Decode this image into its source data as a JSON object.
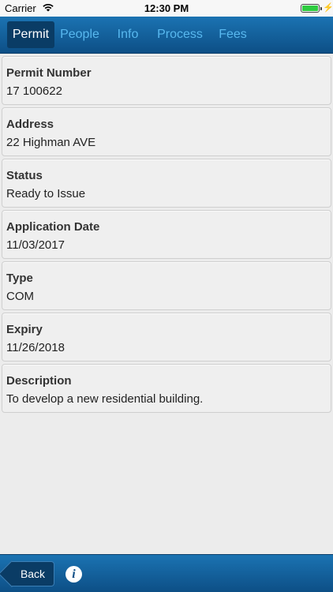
{
  "status_bar": {
    "carrier": "Carrier",
    "time": "12:30 PM",
    "charge_glyph": "⚡"
  },
  "tabs": [
    {
      "label": "Permit",
      "active": true
    },
    {
      "label": "People",
      "active": false
    },
    {
      "label": "Info",
      "active": false
    },
    {
      "label": "Process",
      "active": false
    },
    {
      "label": "Fees",
      "active": false
    }
  ],
  "fields": [
    {
      "label": "Permit Number",
      "value": "17 100622"
    },
    {
      "label": "Address",
      "value": "22 Highman AVE"
    },
    {
      "label": "Status",
      "value": "Ready to Issue"
    },
    {
      "label": "Application Date",
      "value": "11/03/2017"
    },
    {
      "label": "Type",
      "value": "COM"
    },
    {
      "label": "Expiry",
      "value": "11/26/2018"
    },
    {
      "label": "Description",
      "value": "To develop a new residential building."
    }
  ],
  "bottom_bar": {
    "back_label": "Back",
    "info_glyph": "i"
  },
  "colors": {
    "bar_blue": "#0d4f86",
    "active_tab": "#0a3c65",
    "inactive_tab_text": "#58b8ef",
    "card_bg": "#efefef",
    "page_bg": "#ececec"
  }
}
